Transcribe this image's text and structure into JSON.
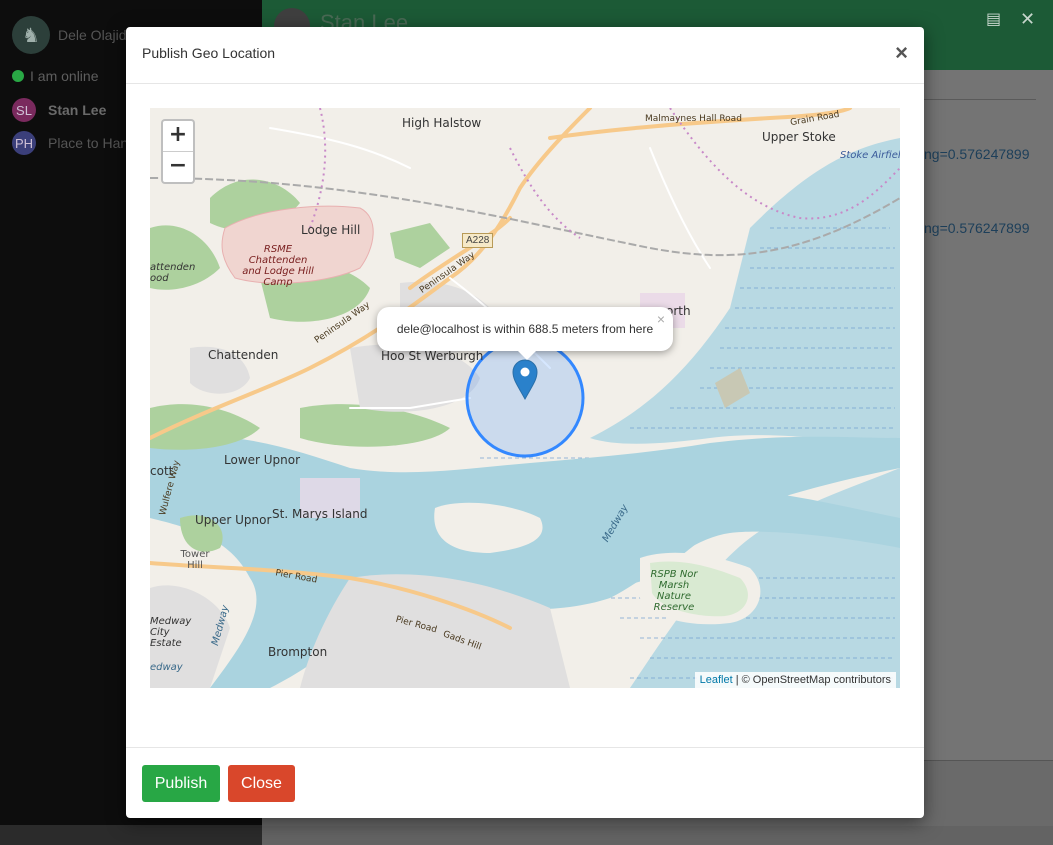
{
  "sidebar": {
    "profile_name": "Dele Olajide",
    "status": "I am online",
    "contacts": [
      {
        "initials": "SL",
        "name": "Stan Lee"
      },
      {
        "initials": "PH",
        "name": "Place to Hang"
      }
    ]
  },
  "chat": {
    "title": "Stan Lee",
    "messages": [
      "ng=0.576247899",
      "ng=0.576247899"
    ]
  },
  "modal": {
    "title": "Publish Geo Location",
    "close_glyph": "×",
    "publish_label": "Publish",
    "close_label": "Close"
  },
  "map": {
    "zoom_in": "+",
    "zoom_out": "−",
    "popup_text": "dele@localhost is within 688.5 meters from here",
    "popup_close": "×",
    "attribution_link": "Leaflet",
    "attribution_text": " | © OpenStreetMap contributors",
    "labels": {
      "high_halstow": "High Halstow",
      "upper_stoke": "Upper Stoke",
      "stoke_airfield": "Stoke Airfield",
      "lodge_hill": "Lodge Hill",
      "rsme": "RSME Chattenden and Lodge Hill Camp",
      "chattenden": "Chattenden",
      "hoo": "Hoo St Werburgh",
      "north": "orth",
      "lower_upnor": "Lower Upnor",
      "upper_upnor": "Upper Upnor",
      "st_marys": "St. Marys Island",
      "tower_hill": "Tower Hill",
      "rspb": "RSPB Nor Marsh Nature Reserve",
      "medway": "Medway",
      "medway_city": "Medway City Estate",
      "brompton": "Brompton",
      "chattenden_wood": "attenden ood",
      "cott": "cott",
      "a228": "A228",
      "peninsula_way": "Peninsula Way",
      "peninsula_way2": "Peninsula Way",
      "malmaynes": "Malmaynes Hall Road",
      "grain_road": "Grain Road",
      "pier_road": "Pier Road",
      "pier_road2": "Pier Road",
      "gads_hill": "Gads Hill",
      "wulfere": "Wulfere Way",
      "medway_small": "Medway",
      "medway_small2": "edway"
    }
  },
  "colors": {
    "publish": "#28a745",
    "close": "#d9472b",
    "header_green": "#1c5a36",
    "water": "#aad3df",
    "circle": "#3388ff"
  },
  "icons": {
    "marker": "map-marker-icon",
    "card": "contact-card-icon",
    "close": "close-icon"
  }
}
